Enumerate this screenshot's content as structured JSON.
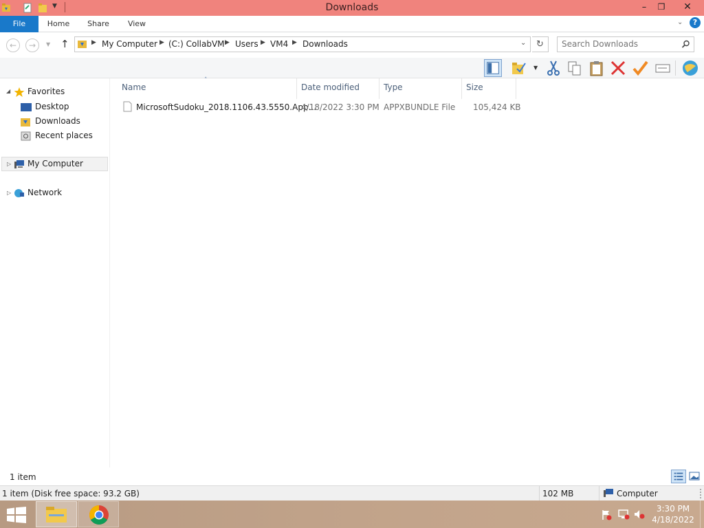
{
  "window": {
    "title": "Downloads"
  },
  "ribbon": {
    "tabs": [
      "File",
      "Home",
      "Share",
      "View"
    ]
  },
  "address": {
    "crumbs": [
      "My Computer",
      "(C:) CollabVM",
      "Users",
      "VM4",
      "Downloads"
    ],
    "search_placeholder": "Search Downloads"
  },
  "navpane": {
    "favorites": "Favorites",
    "favorites_items": [
      "Desktop",
      "Downloads",
      "Recent places"
    ],
    "my_computer": "My Computer",
    "network": "Network"
  },
  "filelist": {
    "columns": [
      "Name",
      "Date modified",
      "Type",
      "Size"
    ],
    "rows": [
      {
        "name": "MicrosoftSudoku_2018.1106.43.5550.App...",
        "date": "4/18/2022 3:30 PM",
        "type": "APPXBUNDLE File",
        "size": "105,424 KB"
      }
    ]
  },
  "status": {
    "item_count": "1 item",
    "bottom_left": "1 item (Disk free space: 93.2 GB)",
    "size": "102 MB",
    "location": "Computer"
  },
  "taskbar": {
    "time": "3:30 PM",
    "date": "4/18/2022"
  },
  "colors": {
    "titlebar": "#f0837d",
    "file_tab": "#1979ca",
    "header_text": "#4c607a"
  }
}
